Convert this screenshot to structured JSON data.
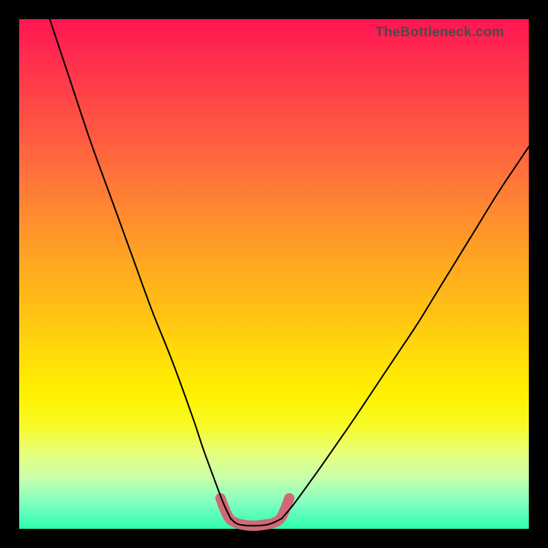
{
  "attribution": "TheBottleneck.com",
  "chart_data": {
    "type": "line",
    "title": "",
    "xlabel": "",
    "ylabel": "",
    "xlim": [
      0,
      100
    ],
    "ylim": [
      0,
      100
    ],
    "series": [
      {
        "name": "left-curve",
        "x": [
          6,
          10,
          14,
          18,
          22,
          26,
          30,
          34,
          36,
          38,
          40,
          41.5
        ],
        "values": [
          100,
          88,
          76,
          65,
          54,
          43,
          33,
          22,
          16,
          10.5,
          5.2,
          2.0
        ]
      },
      {
        "name": "valley-floor",
        "x": [
          41.5,
          43,
          46,
          49,
          51.5
        ],
        "values": [
          2.0,
          0.9,
          0.6,
          0.9,
          2.0
        ]
      },
      {
        "name": "right-curve",
        "x": [
          51.5,
          54,
          58,
          62,
          66,
          70,
          74,
          78,
          82,
          86,
          90,
          94,
          98,
          100
        ],
        "values": [
          2.0,
          5.0,
          10.5,
          16.2,
          22.0,
          28.0,
          34.0,
          40.0,
          46.5,
          53.0,
          59.5,
          66.0,
          72.0,
          75.0
        ]
      }
    ],
    "highlight": {
      "name": "optimal-zone",
      "x": [
        39.5,
        41.0,
        42.5,
        44.0,
        46.0,
        48.0,
        50.0,
        51.5,
        53.0
      ],
      "values": [
        6.0,
        2.4,
        1.2,
        0.8,
        0.6,
        0.8,
        1.2,
        2.4,
        6.0
      ]
    }
  }
}
